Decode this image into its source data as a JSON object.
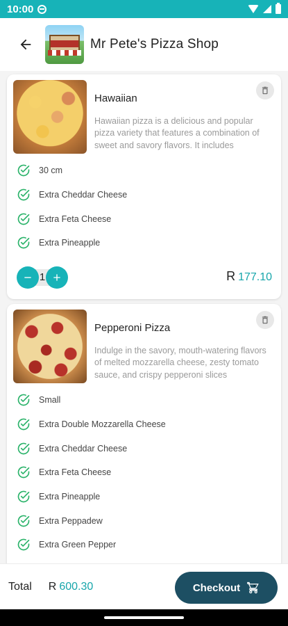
{
  "status_bar": {
    "time": "10:00"
  },
  "header": {
    "shop_name": "Mr Pete's Pizza Shop"
  },
  "colors": {
    "accent": "#17b3b8",
    "price": "#17a6ab",
    "checkout": "#1d4f63"
  },
  "icons": {
    "back": "arrow-left-icon",
    "delete": "trash-icon",
    "check": "check-circle-icon",
    "minus": "minus-icon",
    "plus": "plus-icon",
    "cart": "cart-icon"
  },
  "cart": {
    "items": [
      {
        "title": "Hawaiian",
        "description": "Hawaiian pizza is a delicious and popular pizza variety that features a combination of sweet and savory flavors. It includes",
        "options": [
          "30 cm",
          "Extra Cheddar Cheese",
          "Extra Feta Cheese",
          "Extra Pineapple"
        ],
        "quantity": "1",
        "currency": "R",
        "price": "177.10"
      },
      {
        "title": "Pepperoni Pizza",
        "description": "Indulge in the savory, mouth-watering flavors of melted mozzarella cheese, zesty tomato sauce, and crispy pepperoni slices",
        "options": [
          "Small",
          "Extra Double Mozzarella Cheese",
          "Extra Cheddar Cheese",
          "Extra Feta Cheese",
          "Extra Pineapple",
          "Extra Peppadew",
          "Extra Green Pepper"
        ]
      }
    ]
  },
  "footer": {
    "total_label": "Total",
    "currency": "R",
    "total_amount": "600.30",
    "checkout_label": "Checkout"
  }
}
